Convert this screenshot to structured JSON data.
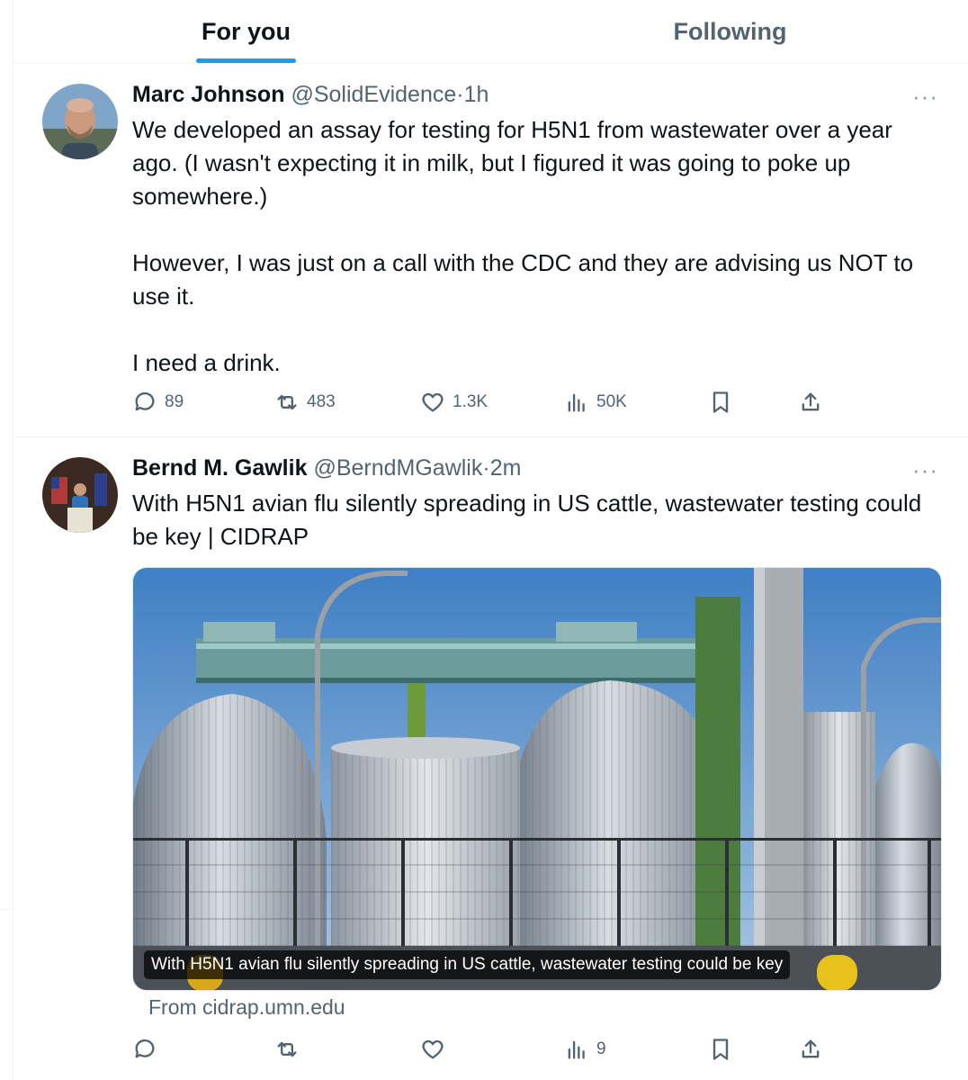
{
  "tabs": [
    {
      "label": "For you",
      "active": true
    },
    {
      "label": "Following",
      "active": false
    }
  ],
  "tweets": [
    {
      "name": "Marc Johnson",
      "handle": "@SolidEvidence",
      "separator": "·",
      "time": "1h",
      "more": "···",
      "text": [
        "We developed an assay for testing for H5N1 from wastewater over a year ago.  (I wasn't expecting it in milk, but I figured it was going to poke up somewhere.)",
        "However, I was just on a call with the CDC and they are advising us NOT to use it.",
        "I need a drink."
      ],
      "stats": {
        "replies": "89",
        "reposts": "483",
        "likes": "1.3K",
        "views": "50K"
      }
    },
    {
      "name": "Bernd M. Gawlik",
      "handle": "@BerndMGawlik",
      "separator": "·",
      "time": "2m",
      "more": "···",
      "text": [
        "With H5N1 avian flu silently spreading in US cattle, wastewater testing could be key | CIDRAP"
      ],
      "card": {
        "caption": "With H5N1 avian flu silently spreading in US cattle, wastewater testing could be key",
        "source": "From cidrap.umn.edu"
      },
      "stats": {
        "replies": "",
        "reposts": "",
        "likes": "",
        "views": "9"
      }
    }
  ],
  "icons": {
    "reply": "reply-icon",
    "repost": "repost-icon",
    "like": "like-icon",
    "views": "views-icon",
    "bookmark": "bookmark-icon",
    "share": "share-icon"
  },
  "colors": {
    "accent": "#1d9bf0",
    "secondary_text": "#536471",
    "border": "#eff3f4"
  }
}
